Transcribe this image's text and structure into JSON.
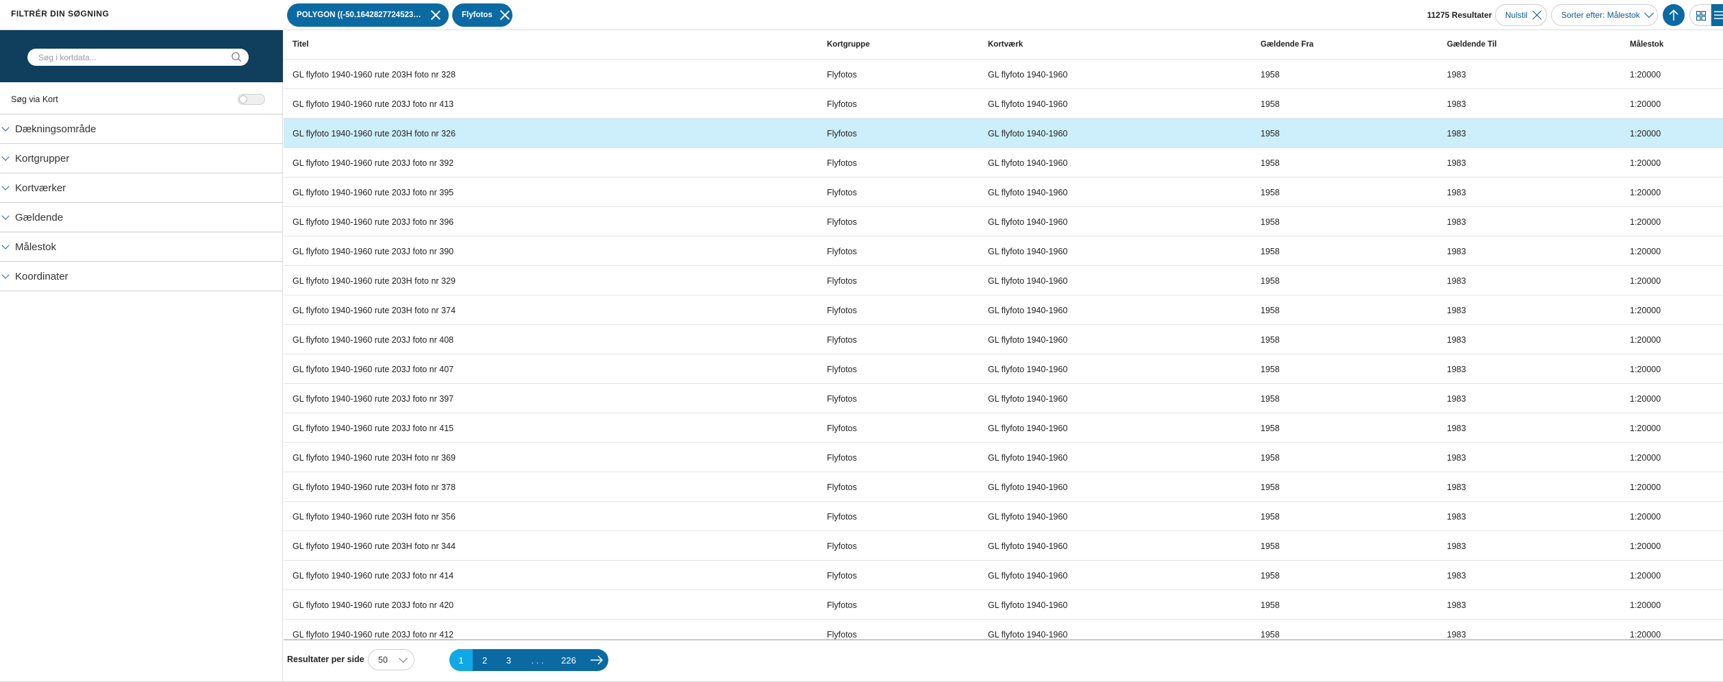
{
  "sidebar": {
    "title": "FILTRÉR DIN SØGNING",
    "search_placeholder": "Søg i kortdata...",
    "map_search_label": "Søg via Kort",
    "facets": [
      {
        "label": "Dækningsområde"
      },
      {
        "label": "Kortgrupper"
      },
      {
        "label": "Kortværker"
      },
      {
        "label": "Gældende"
      },
      {
        "label": "Målestok"
      },
      {
        "label": "Koordinater"
      }
    ]
  },
  "filters": {
    "chips": [
      {
        "label": "POLYGON ((-50.16428277245238 ..."
      },
      {
        "label": "Flyfotos"
      }
    ]
  },
  "toolbar": {
    "results": "11275 Resultater",
    "reset_label": "Nulstil",
    "sort_label": "Sorter efter: Målestok"
  },
  "table": {
    "columns": [
      "Titel",
      "Kortgruppe",
      "Kortværk",
      "Gældende Fra",
      "Gældende Til",
      "Målestok"
    ],
    "rows": [
      {
        "titel": "GL flyfoto 1940-1960 rute 203H foto nr 328",
        "kortgruppe": "Flyfotos",
        "kortvaerk": "GL flyfoto 1940-1960",
        "fra": "1958",
        "til": "1983",
        "malestok": "1:20000"
      },
      {
        "titel": "GL flyfoto 1940-1960 rute 203J foto nr 413",
        "kortgruppe": "Flyfotos",
        "kortvaerk": "GL flyfoto 1940-1960",
        "fra": "1958",
        "til": "1983",
        "malestok": "1:20000"
      },
      {
        "titel": "GL flyfoto 1940-1960 rute 203H foto nr 326",
        "kortgruppe": "Flyfotos",
        "kortvaerk": "GL flyfoto 1940-1960",
        "fra": "1958",
        "til": "1983",
        "malestok": "1:20000",
        "selected": true
      },
      {
        "titel": "GL flyfoto 1940-1960 rute 203J foto nr 392",
        "kortgruppe": "Flyfotos",
        "kortvaerk": "GL flyfoto 1940-1960",
        "fra": "1958",
        "til": "1983",
        "malestok": "1:20000"
      },
      {
        "titel": "GL flyfoto 1940-1960 rute 203J foto nr 395",
        "kortgruppe": "Flyfotos",
        "kortvaerk": "GL flyfoto 1940-1960",
        "fra": "1958",
        "til": "1983",
        "malestok": "1:20000"
      },
      {
        "titel": "GL flyfoto 1940-1960 rute 203J foto nr 396",
        "kortgruppe": "Flyfotos",
        "kortvaerk": "GL flyfoto 1940-1960",
        "fra": "1958",
        "til": "1983",
        "malestok": "1:20000"
      },
      {
        "titel": "GL flyfoto 1940-1960 rute 203J foto nr 390",
        "kortgruppe": "Flyfotos",
        "kortvaerk": "GL flyfoto 1940-1960",
        "fra": "1958",
        "til": "1983",
        "malestok": "1:20000"
      },
      {
        "titel": "GL flyfoto 1940-1960 rute 203H foto nr 329",
        "kortgruppe": "Flyfotos",
        "kortvaerk": "GL flyfoto 1940-1960",
        "fra": "1958",
        "til": "1983",
        "malestok": "1:20000"
      },
      {
        "titel": "GL flyfoto 1940-1960 rute 203H foto nr 374",
        "kortgruppe": "Flyfotos",
        "kortvaerk": "GL flyfoto 1940-1960",
        "fra": "1958",
        "til": "1983",
        "malestok": "1:20000"
      },
      {
        "titel": "GL flyfoto 1940-1960 rute 203J foto nr 408",
        "kortgruppe": "Flyfotos",
        "kortvaerk": "GL flyfoto 1940-1960",
        "fra": "1958",
        "til": "1983",
        "malestok": "1:20000"
      },
      {
        "titel": "GL flyfoto 1940-1960 rute 203J foto nr 407",
        "kortgruppe": "Flyfotos",
        "kortvaerk": "GL flyfoto 1940-1960",
        "fra": "1958",
        "til": "1983",
        "malestok": "1:20000"
      },
      {
        "titel": "GL flyfoto 1940-1960 rute 203J foto nr 397",
        "kortgruppe": "Flyfotos",
        "kortvaerk": "GL flyfoto 1940-1960",
        "fra": "1958",
        "til": "1983",
        "malestok": "1:20000"
      },
      {
        "titel": "GL flyfoto 1940-1960 rute 203J foto nr 415",
        "kortgruppe": "Flyfotos",
        "kortvaerk": "GL flyfoto 1940-1960",
        "fra": "1958",
        "til": "1983",
        "malestok": "1:20000"
      },
      {
        "titel": "GL flyfoto 1940-1960 rute 203H foto nr 369",
        "kortgruppe": "Flyfotos",
        "kortvaerk": "GL flyfoto 1940-1960",
        "fra": "1958",
        "til": "1983",
        "malestok": "1:20000"
      },
      {
        "titel": "GL flyfoto 1940-1960 rute 203H foto nr 378",
        "kortgruppe": "Flyfotos",
        "kortvaerk": "GL flyfoto 1940-1960",
        "fra": "1958",
        "til": "1983",
        "malestok": "1:20000"
      },
      {
        "titel": "GL flyfoto 1940-1960 rute 203H foto nr 356",
        "kortgruppe": "Flyfotos",
        "kortvaerk": "GL flyfoto 1940-1960",
        "fra": "1958",
        "til": "1983",
        "malestok": "1:20000"
      },
      {
        "titel": "GL flyfoto 1940-1960 rute 203H foto nr 344",
        "kortgruppe": "Flyfotos",
        "kortvaerk": "GL flyfoto 1940-1960",
        "fra": "1958",
        "til": "1983",
        "malestok": "1:20000"
      },
      {
        "titel": "GL flyfoto 1940-1960 rute 203J foto nr 414",
        "kortgruppe": "Flyfotos",
        "kortvaerk": "GL flyfoto 1940-1960",
        "fra": "1958",
        "til": "1983",
        "malestok": "1:20000"
      },
      {
        "titel": "GL flyfoto 1940-1960 rute 203J foto nr 420",
        "kortgruppe": "Flyfotos",
        "kortvaerk": "GL flyfoto 1940-1960",
        "fra": "1958",
        "til": "1983",
        "malestok": "1:20000"
      },
      {
        "titel": "GL flyfoto 1940-1960 rute 203J foto nr 412",
        "kortgruppe": "Flyfotos",
        "kortvaerk": "GL flyfoto 1940-1960",
        "fra": "1958",
        "til": "1983",
        "malestok": "1:20000"
      }
    ]
  },
  "footer": {
    "per_page_label": "Resultater per side",
    "per_page_value": "50",
    "pages": [
      "1",
      "2",
      "3",
      ". . .",
      "226"
    ],
    "active_page": "1"
  },
  "icons": {
    "search": "search-icon",
    "close": "close-icon",
    "chevron": "chevron-down-icon",
    "sort_direction": "arrow-up-icon",
    "grid_view": "grid-icon",
    "list_view": "list-icon",
    "next": "arrow-right-icon"
  },
  "colors": {
    "primary": "#0b6aa2",
    "sidebar_header": "#0f3f5c",
    "selected_row": "#cdeefb",
    "active_page": "#10a8e6"
  }
}
